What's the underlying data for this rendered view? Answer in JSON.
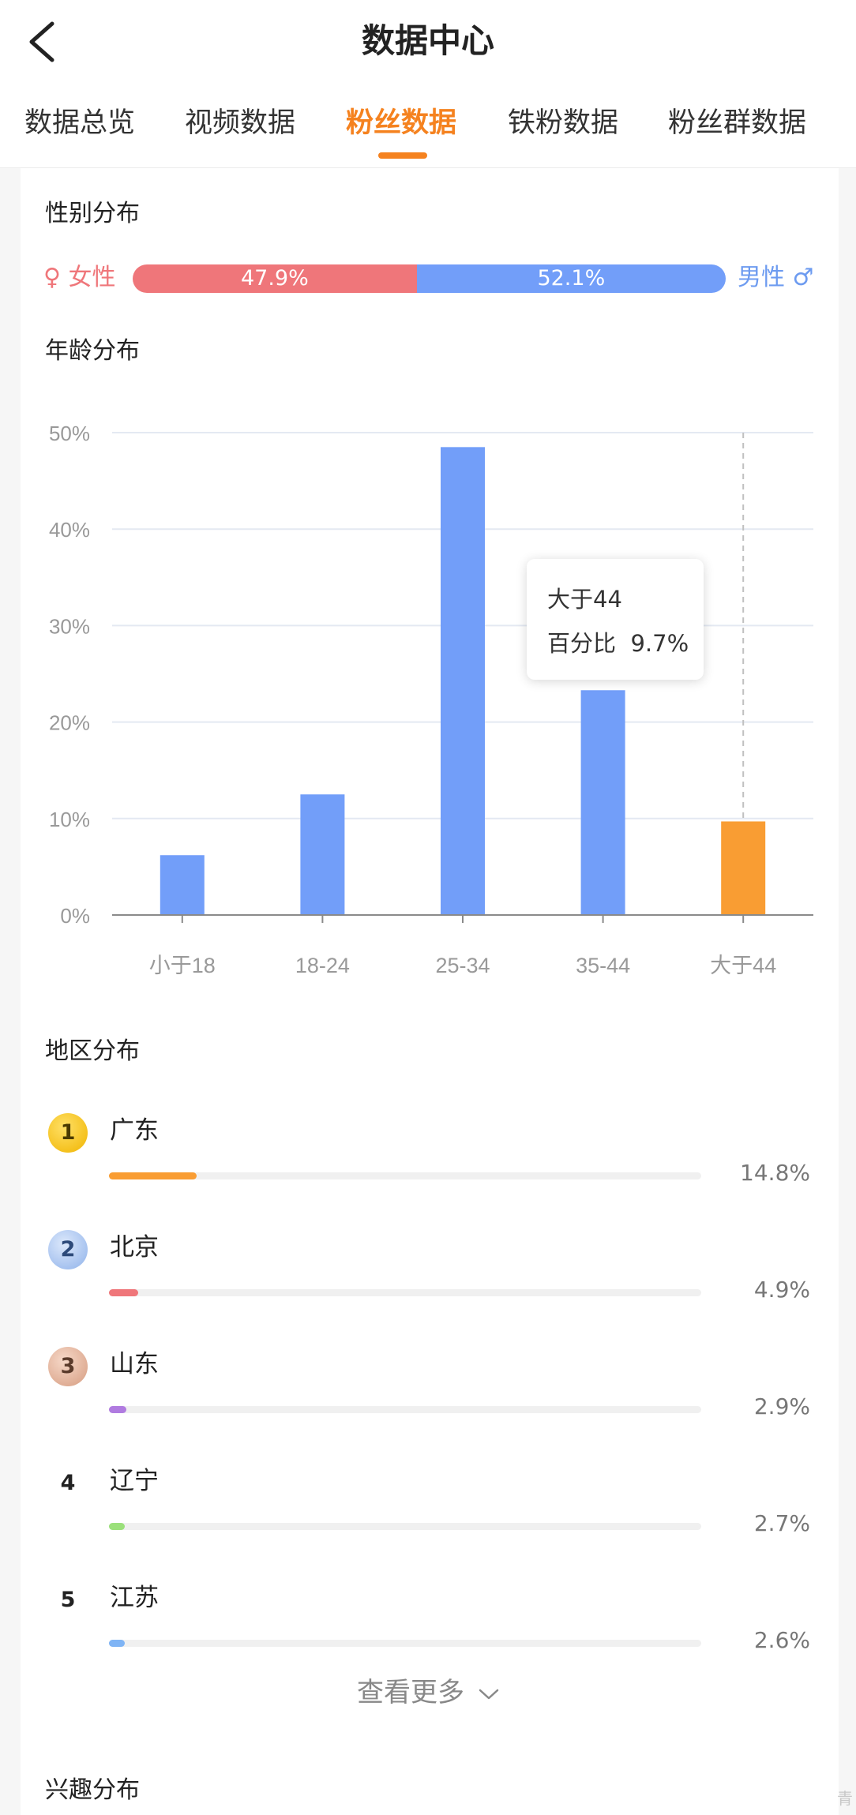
{
  "header": {
    "title": "数据中心",
    "tabs": [
      "数据总览",
      "视频数据",
      "粉丝数据",
      "铁粉数据",
      "粉丝群数据"
    ],
    "active_tab": 2
  },
  "gender": {
    "title": "性别分布",
    "female_label": "女性",
    "male_label": "男性",
    "female_symbol": "♀",
    "male_symbol": "♂",
    "female_pct": 47.9,
    "male_pct": 52.1,
    "female_text": "47.9%",
    "male_text": "52.1%",
    "female_color": "#ef767a",
    "male_color": "#729ef9"
  },
  "age": {
    "title": "年龄分布"
  },
  "chart_data": {
    "type": "bar",
    "categories": [
      "小于18",
      "18-24",
      "25-34",
      "35-44",
      "大于44"
    ],
    "values": [
      6.2,
      12.5,
      48.5,
      23.3,
      9.7
    ],
    "ylim": [
      0,
      50
    ],
    "yticks": [
      "0%",
      "10%",
      "20%",
      "30%",
      "40%",
      "50%"
    ],
    "highlight_index": 4,
    "bar_color": "#729ef9",
    "highlight_color": "#f99d33",
    "grid": true,
    "tooltip": {
      "category": "大于44",
      "label": "百分比",
      "value": "9.7%"
    }
  },
  "region": {
    "title": "地区分布",
    "items": [
      {
        "rank": "1",
        "name": "广东",
        "value": 14.8,
        "pct_text": "14.8%",
        "color": "#f99d33",
        "badge": "gold"
      },
      {
        "rank": "2",
        "name": "北京",
        "value": 4.9,
        "pct_text": "4.9%",
        "color": "#ef767a",
        "badge": "silver"
      },
      {
        "rank": "3",
        "name": "山东",
        "value": 2.9,
        "pct_text": "2.9%",
        "color": "#b07be0",
        "badge": "bronze"
      },
      {
        "rank": "4",
        "name": "辽宁",
        "value": 2.7,
        "pct_text": "2.7%",
        "color": "#9be07b",
        "badge": "none"
      },
      {
        "rank": "5",
        "name": "江苏",
        "value": 2.6,
        "pct_text": "2.6%",
        "color": "#7fb4f5",
        "badge": "none"
      }
    ],
    "more_label": "查看更多"
  },
  "interest": {
    "title": "兴趣分布"
  },
  "watermark": "青"
}
